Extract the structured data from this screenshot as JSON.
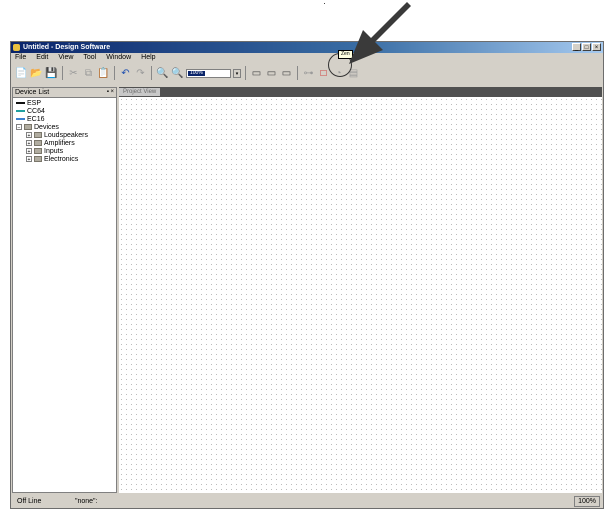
{
  "window": {
    "title": "Untitled - Design Software"
  },
  "window_buttons": {
    "minimize": "_",
    "maximize": "□",
    "close": "×"
  },
  "menu": [
    {
      "label": "File"
    },
    {
      "label": "Edit"
    },
    {
      "label": "View"
    },
    {
      "label": "Tool"
    },
    {
      "label": "Window"
    },
    {
      "label": "Help"
    }
  ],
  "toolbar": {
    "new_icon": "📄",
    "open_icon": "📂",
    "save_icon": "💾",
    "cut_icon": "✂",
    "copy_icon": "⧉",
    "paste_icon": "📋",
    "undo_icon": "↶",
    "redo_icon": "↷",
    "zoom_in_icon": "🔍",
    "zoom_out_icon": "🔍",
    "zoom_value": "100%",
    "zoom_dropdown": "▾",
    "view1_icon": "▭",
    "view2_icon": "▭",
    "view3_icon": "▭",
    "connect_icon": "⊶",
    "draw_icon": "□",
    "tool2_icon": "◔",
    "tool3_icon": "▤"
  },
  "tooltip": "Zen",
  "device_list": {
    "title": "Device List",
    "controls": "▪ ×",
    "items": [
      {
        "label": "ESP"
      },
      {
        "label": "CC64"
      },
      {
        "label": "EC16"
      },
      {
        "label": "Devices",
        "expand": "⊟"
      },
      {
        "label": "Loudspeakers",
        "expand": "⊞"
      },
      {
        "label": "Amplifiers",
        "expand": "⊞"
      },
      {
        "label": "Inputs",
        "expand": "⊞"
      },
      {
        "label": "Electronics",
        "expand": "⊞"
      }
    ]
  },
  "project_view": {
    "tab": "Project View"
  },
  "status": {
    "state": "Off Line",
    "selection": "\"none\":",
    "zoom": "100%"
  },
  "colors": {
    "title_start": "#0a246a",
    "title_end": "#a6caf0",
    "arrow": "#3a3a3a"
  }
}
